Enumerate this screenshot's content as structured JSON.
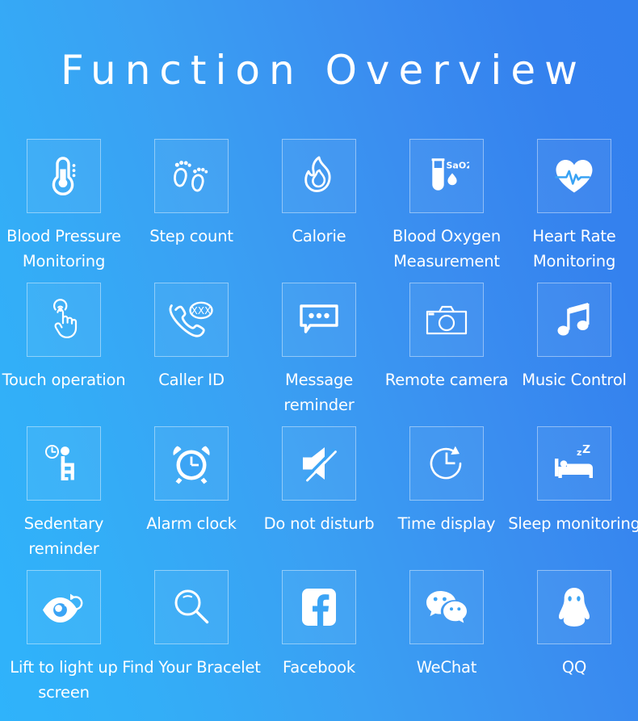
{
  "page": {
    "title": "Function Overview",
    "background_gradient_from": "#2fb3fb",
    "background_gradient_to": "#3280ee",
    "text_color": "#ffffff",
    "columns": 5,
    "rows": 4
  },
  "features": [
    {
      "icon": "thermometer-icon",
      "label": "Blood Pressure Monitoring",
      "badge": ""
    },
    {
      "icon": "footprints-icon",
      "label": "Step count",
      "badge": ""
    },
    {
      "icon": "flame-icon",
      "label": "Calorie",
      "badge": ""
    },
    {
      "icon": "test-tube-sao2-icon",
      "label": "Blood Oxygen Measurement",
      "badge": "SaO2"
    },
    {
      "icon": "heart-pulse-icon",
      "label": "Heart Rate Monitoring",
      "badge": ""
    },
    {
      "icon": "touch-hand-icon",
      "label": "Touch operation",
      "badge": ""
    },
    {
      "icon": "phone-caller-id-icon",
      "label": "Caller ID",
      "badge": "XXX"
    },
    {
      "icon": "speech-bubble-icon",
      "label": "Message reminder",
      "badge": ""
    },
    {
      "icon": "camera-icon",
      "label": "Remote camera",
      "badge": ""
    },
    {
      "icon": "music-note-icon",
      "label": "Music Control",
      "badge": ""
    },
    {
      "icon": "sedentary-person-icon",
      "label": "Sedentary reminder",
      "badge": ""
    },
    {
      "icon": "alarm-clock-icon",
      "label": "Alarm clock",
      "badge": ""
    },
    {
      "icon": "mute-speaker-icon",
      "label": "Do not disturb",
      "badge": ""
    },
    {
      "icon": "clock-refresh-icon",
      "label": "Time display",
      "badge": ""
    },
    {
      "icon": "sleep-bed-icon",
      "label": "Sleep monitoring",
      "badge": "zZ"
    },
    {
      "icon": "eye-refresh-icon",
      "label": "Lift to light up screen",
      "badge": ""
    },
    {
      "icon": "magnifier-icon",
      "label": "Find Your Bracelet",
      "badge": ""
    },
    {
      "icon": "facebook-icon",
      "label": "Facebook",
      "badge": ""
    },
    {
      "icon": "wechat-icon",
      "label": "WeChat",
      "badge": ""
    },
    {
      "icon": "qq-penguin-icon",
      "label": "QQ",
      "badge": ""
    }
  ]
}
